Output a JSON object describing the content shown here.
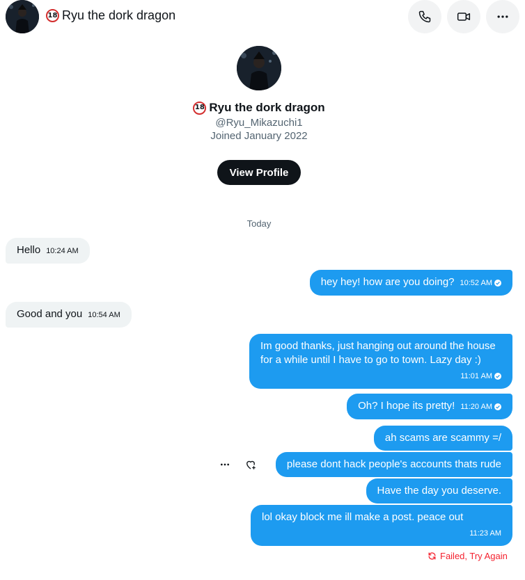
{
  "header": {
    "badge": "18",
    "title": "Ryu the dork dragon",
    "icons": [
      "phone-icon",
      "video-camera-icon",
      "more-icon"
    ]
  },
  "profile": {
    "badge": "18",
    "name": "Ryu the dork dragon",
    "handle": "@Ryu_Mikazuchi1",
    "joined": "Joined January 2022",
    "view_profile_label": "View Profile"
  },
  "conversation": {
    "date_label": "Today",
    "messages": [
      {
        "side": "in",
        "text": "Hello",
        "time": "10:24 AM"
      },
      {
        "side": "out",
        "text": "hey hey! how are you doing?",
        "time": "10:52 AM",
        "status": "sent"
      },
      {
        "side": "in",
        "text": "Good and you",
        "time": "10:54 AM"
      },
      {
        "side": "out",
        "text": "Im good thanks, just hanging out around the house for a while until I have to go to town. Lazy day :)",
        "time": "11:01 AM",
        "status": "sent"
      },
      {
        "side": "out",
        "text": "Oh? I hope its pretty!",
        "time": "11:20 AM",
        "status": "sent"
      },
      {
        "side": "out",
        "text": "ah scams are scammy =/",
        "time": ""
      },
      {
        "side": "out",
        "text": "please dont hack people's accounts thats rude",
        "time": ""
      },
      {
        "side": "out",
        "text": "Have the day you deserve.",
        "time": ""
      },
      {
        "side": "out",
        "text": "lol okay block me ill make a post. peace out",
        "time": "11:23 AM",
        "status": "failed"
      }
    ],
    "failed_label": "Failed, Try Again"
  },
  "colors": {
    "outgoing_bubble": "#1d9bf0",
    "incoming_bubble": "#eff3f4",
    "error": "#f4212e",
    "primary_button": "#0f1419"
  }
}
